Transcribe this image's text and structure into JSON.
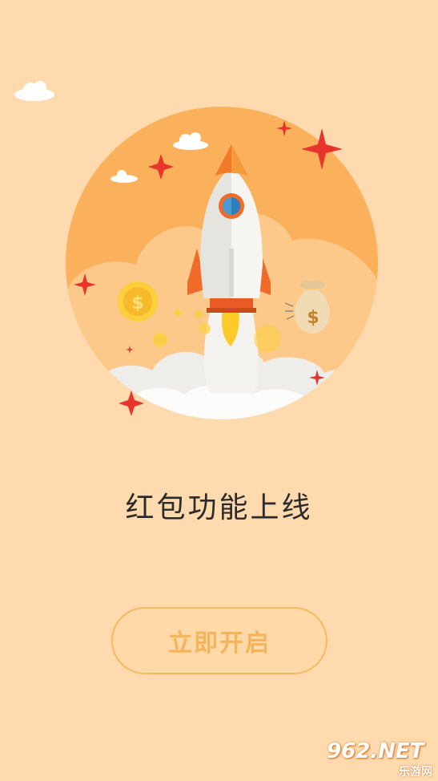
{
  "promo": {
    "headline": "红包功能上线",
    "start_button_label": "立即开启"
  },
  "watermark": {
    "brand": "962.NET",
    "subtitle": "乐游网"
  },
  "colors": {
    "background": "#FFDAAE",
    "circle": "#FBB05C",
    "button_border": "#F8B862",
    "button_text": "#F5B45C",
    "sparkle": "#E8352B"
  },
  "icons": [
    "cloud-icon",
    "rocket-icon",
    "coin-icon",
    "money-bag-icon",
    "sparkle-icon"
  ]
}
